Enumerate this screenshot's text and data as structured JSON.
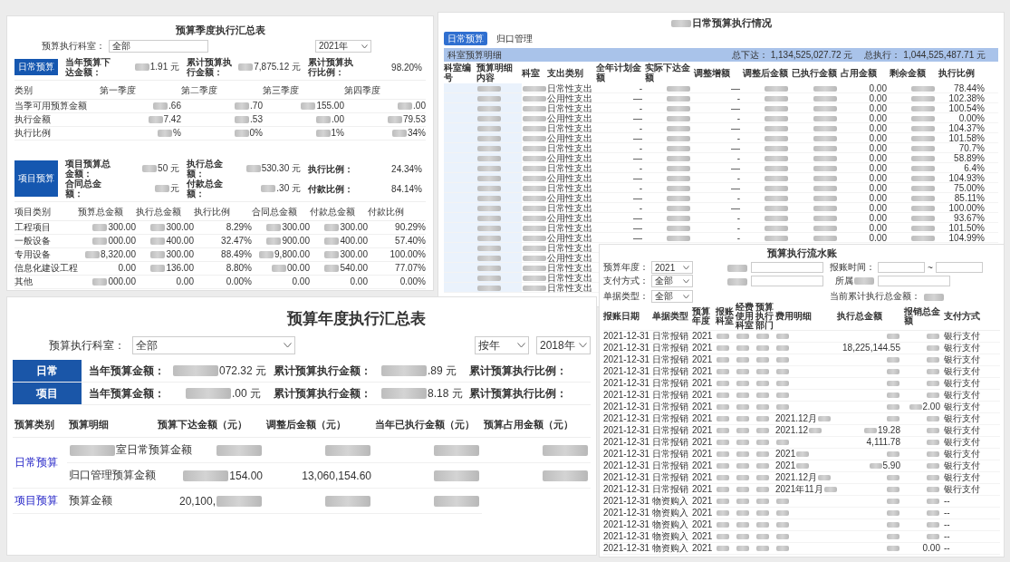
{
  "quarterly": {
    "title": "预算季度执行汇总表",
    "dept_label": "预算执行科室：",
    "dept_value": "全部",
    "year": "2021年",
    "daily_button": "日常预算",
    "daily_summary": [
      {
        "label": "当年预算下达金额：",
        "value": {
          "masked": true,
          "text": "1.91 元"
        }
      },
      {
        "label": "累计预算执行金额：",
        "value": {
          "masked": true,
          "text": "7,875.12 元"
        }
      },
      {
        "label": "累计预算执行比例：",
        "value": "98.20%"
      }
    ],
    "columns": [
      "类别",
      "第一季度",
      "第二季度",
      "第三季度",
      "第四季度"
    ],
    "rows": [
      {
        "label": "当季可用预算金额",
        "cells": [
          {
            "masked": true,
            "text": ".66"
          },
          {
            "masked": true,
            "text": ".70"
          },
          {
            "masked": true,
            "text": "155.00"
          },
          {
            "masked": true,
            "text": ".00"
          }
        ]
      },
      {
        "label": "执行金额",
        "cells": [
          {
            "masked": true,
            "text": "7.42"
          },
          {
            "masked": true,
            "text": ".53"
          },
          {
            "masked": true,
            "text": ".00"
          },
          {
            "masked": true,
            "text": "79.53"
          }
        ]
      },
      {
        "label": "执行比例",
        "cells": [
          {
            "masked": true,
            "text": "%"
          },
          {
            "masked": true,
            "text": "0%"
          },
          {
            "masked": true,
            "text": "1%"
          },
          {
            "masked": true,
            "text": "34%"
          }
        ]
      }
    ],
    "project_button": "项目预算",
    "project_summary": [
      {
        "label": "项目预算总金额：",
        "value": {
          "masked": true,
          "text": "50 元"
        }
      },
      {
        "label": "执行总金额：",
        "value": {
          "masked": true,
          "text": "530.30 元"
        }
      },
      {
        "label": "执行比例：",
        "value": "24.34%"
      },
      {
        "label": "合同总金额：",
        "value": {
          "masked": true,
          "text": "元"
        }
      },
      {
        "label": "付款总金额：",
        "value": {
          "masked": true,
          "text": ".30 元"
        }
      },
      {
        "label": "付款比例：",
        "value": "84.14%"
      }
    ],
    "project_columns": [
      "项目类别",
      "预算总金额",
      "执行总金额",
      "执行比例",
      "合同总金额",
      "付款总金额",
      "付款比例"
    ],
    "project_rows": [
      {
        "label": "工程项目",
        "cells": [
          {
            "masked": true,
            "text": "300.00"
          },
          {
            "masked": true,
            "text": "300.00"
          },
          "8.29%",
          {
            "masked": true,
            "text": "300.00"
          },
          {
            "masked": true,
            "text": "300.00"
          },
          "90.29%"
        ]
      },
      {
        "label": "一般设备",
        "cells": [
          {
            "masked": true,
            "text": "000.00"
          },
          {
            "masked": true,
            "text": "400.00"
          },
          "32.47%",
          {
            "masked": true,
            "text": "900.00"
          },
          {
            "masked": true,
            "text": "400.00"
          },
          "57.40%"
        ]
      },
      {
        "label": "专用设备",
        "cells": [
          {
            "masked": true,
            "text": "8,320.00"
          },
          {
            "masked": true,
            "text": "300.00"
          },
          "88.49%",
          {
            "masked": true,
            "text": "9,800.00"
          },
          {
            "masked": true,
            "text": "300.00"
          },
          "100.00%"
        ]
      },
      {
        "label": "信息化建设工程",
        "cells": [
          "0.00",
          {
            "masked": true,
            "text": "136.00"
          },
          "8.80%",
          {
            "masked": true,
            "text": "00.00"
          },
          {
            "masked": true,
            "text": "540.00"
          },
          "77.07%"
        ]
      },
      {
        "label": "其他",
        "cells": [
          {
            "masked": true,
            "text": "000.00"
          },
          "0.00",
          "0.00%",
          "0.00",
          "0.00",
          "0.00%"
        ]
      }
    ]
  },
  "daily_status": {
    "title": {
      "masked": true,
      "text": "日常预算执行情况"
    },
    "tabs": [
      {
        "label": "日常预算",
        "selected": true
      },
      {
        "label": "归口管理",
        "selected": false
      }
    ],
    "bar_label": "科室预算明细",
    "totals": [
      {
        "label": "总下达：",
        "value": "1,134,525,027.72 元"
      },
      {
        "label": "总执行：",
        "value": "1,044,525,487.71 元"
      }
    ],
    "columns": [
      "科室编号",
      "预算明细内容",
      "科室",
      "支出类别",
      "全年计划金额",
      "实际下达金额",
      "调整增额",
      "调整后金额",
      "已执行金额",
      "占用金额",
      "剩余金额",
      "执行比例"
    ],
    "rows": [
      [
        "",
        {
          "masked": true
        },
        {
          "masked": true
        },
        "日常性支出",
        "-",
        {
          "masked": true
        },
        "—",
        {
          "masked": true
        },
        {
          "masked": true
        },
        "0.00",
        {
          "masked": true
        },
        "78.44%"
      ],
      [
        "",
        {
          "masked": true
        },
        {
          "masked": true
        },
        "公用性支出",
        "—",
        {
          "masked": true
        },
        "-",
        {
          "masked": true
        },
        {
          "masked": true
        },
        "0.00",
        {
          "masked": true
        },
        "102.38%"
      ],
      [
        "",
        {
          "masked": true
        },
        {
          "masked": true
        },
        "日常性支出",
        "-",
        {
          "masked": true
        },
        "—",
        {
          "masked": true
        },
        {
          "masked": true
        },
        "0.00",
        {
          "masked": true
        },
        "100.54%"
      ],
      [
        "",
        {
          "masked": true
        },
        {
          "masked": true
        },
        "公用性支出",
        "—",
        {
          "masked": true
        },
        "-",
        {
          "masked": true
        },
        {
          "masked": true
        },
        "0.00",
        {
          "masked": true
        },
        "0.00%"
      ],
      [
        "",
        {
          "masked": true
        },
        {
          "masked": true
        },
        "日常性支出",
        "-",
        {
          "masked": true
        },
        "—",
        {
          "masked": true
        },
        {
          "masked": true
        },
        "0.00",
        {
          "masked": true
        },
        "104.37%"
      ],
      [
        "",
        {
          "masked": true
        },
        {
          "masked": true
        },
        "公用性支出",
        "—",
        {
          "masked": true
        },
        "-",
        {
          "masked": true
        },
        {
          "masked": true
        },
        "0.00",
        {
          "masked": true
        },
        "101.58%"
      ],
      [
        "",
        {
          "masked": true
        },
        {
          "masked": true
        },
        "日常性支出",
        "-",
        {
          "masked": true
        },
        "—",
        {
          "masked": true
        },
        {
          "masked": true
        },
        "0.00",
        {
          "masked": true
        },
        "70.7%"
      ],
      [
        "",
        {
          "masked": true
        },
        {
          "masked": true
        },
        "公用性支出",
        "—",
        {
          "masked": true
        },
        "-",
        {
          "masked": true
        },
        {
          "masked": true
        },
        "0.00",
        {
          "masked": true
        },
        "58.89%"
      ],
      [
        "",
        {
          "masked": true
        },
        {
          "masked": true
        },
        "日常性支出",
        "-",
        {
          "masked": true
        },
        "—",
        {
          "masked": true
        },
        {
          "masked": true
        },
        "0.00",
        {
          "masked": true
        },
        "6.4%"
      ],
      [
        "",
        {
          "masked": true
        },
        {
          "masked": true
        },
        "公用性支出",
        "—",
        {
          "masked": true
        },
        "-",
        {
          "masked": true
        },
        {
          "masked": true
        },
        "0.00",
        {
          "masked": true
        },
        "104.93%"
      ],
      [
        "",
        {
          "masked": true
        },
        {
          "masked": true
        },
        "日常性支出",
        "-",
        {
          "masked": true
        },
        "—",
        {
          "masked": true
        },
        {
          "masked": true
        },
        "0.00",
        {
          "masked": true
        },
        "75.00%"
      ],
      [
        "",
        {
          "masked": true
        },
        {
          "masked": true
        },
        "公用性支出",
        "—",
        {
          "masked": true
        },
        "-",
        {
          "masked": true
        },
        {
          "masked": true
        },
        "0.00",
        {
          "masked": true
        },
        "85.11%"
      ],
      [
        "",
        {
          "masked": true
        },
        {
          "masked": true
        },
        "日常性支出",
        "-",
        {
          "masked": true
        },
        "—",
        {
          "masked": true
        },
        {
          "masked": true
        },
        "0.00",
        {
          "masked": true
        },
        "100.00%"
      ],
      [
        "",
        {
          "masked": true
        },
        {
          "masked": true
        },
        "公用性支出",
        "—",
        {
          "masked": true
        },
        "-",
        {
          "masked": true
        },
        {
          "masked": true
        },
        "0.00",
        {
          "masked": true
        },
        "93.67%"
      ],
      [
        "",
        {
          "masked": true
        },
        {
          "masked": true
        },
        "日常性支出",
        "—",
        {
          "masked": true
        },
        "-",
        {
          "masked": true
        },
        {
          "masked": true
        },
        "0.00",
        {
          "masked": true
        },
        "101.50%"
      ],
      [
        "",
        {
          "masked": true
        },
        {
          "masked": true
        },
        "公用性支出",
        "—",
        {
          "masked": true
        },
        "-",
        {
          "masked": true
        },
        {
          "masked": true
        },
        "0.00",
        {
          "masked": true
        },
        "104.99%"
      ],
      [
        "",
        {
          "masked": true
        },
        {
          "masked": true
        },
        "日常性支出"
      ],
      [
        "",
        {
          "masked": true
        },
        {
          "masked": true
        },
        "公用性支出"
      ],
      [
        "",
        {
          "masked": true
        },
        {
          "masked": true
        },
        "日常性支出"
      ],
      [
        "",
        {
          "masked": true
        },
        {
          "masked": true
        },
        "日常性支出"
      ],
      [
        "",
        {
          "masked": true
        },
        {
          "masked": true
        },
        "日常性支出"
      ]
    ]
  },
  "ledger": {
    "title": "预算执行流水账",
    "filter_rows": [
      [
        {
          "kind": "select",
          "label": "预算年度：",
          "value": "2021"
        },
        {
          "kind": "input",
          "label": {
            "masked": true
          }
        },
        {
          "kind": "range",
          "label": "报账时间：",
          "sep": "~"
        }
      ],
      [
        {
          "kind": "select",
          "label": "支付方式：",
          "value": "全部"
        },
        {
          "kind": "input",
          "label": {
            "masked": true
          }
        },
        {
          "kind": "input",
          "label": {
            "masked": true,
            "lead": "所属"
          }
        }
      ],
      [
        {
          "kind": "select",
          "label": "单据类型：",
          "value": "全部"
        },
        {
          "kind": "total",
          "label": "当前累计执行总金额：",
          "value": {
            "masked": true
          }
        }
      ]
    ],
    "columns": [
      "报账日期",
      "单据类型",
      "预算年度",
      "报账科室",
      "经费使用科室",
      "预算执行部门",
      "费用明细",
      "执行总金额",
      "报销总金额",
      "支付方式"
    ],
    "rows": [
      [
        "2021-12-31",
        "日常报销",
        "2021",
        {
          "masked": true
        },
        {
          "masked": true
        },
        {
          "masked": true
        },
        {
          "masked": true
        },
        {
          "masked": true
        },
        {
          "masked": true
        },
        "银行支付"
      ],
      [
        "2021-12-31",
        "日常报销",
        "2021",
        {
          "masked": true
        },
        {
          "masked": true
        },
        {
          "masked": true
        },
        {
          "masked": true
        },
        "18,225,144.55",
        {
          "masked": true
        },
        "银行支付"
      ],
      [
        "2021-12-31",
        "日常报销",
        "2021",
        {
          "masked": true
        },
        {
          "masked": true
        },
        {
          "masked": true
        },
        {
          "masked": true
        },
        {
          "masked": true
        },
        {
          "masked": true
        },
        "银行支付"
      ],
      [
        "2021-12-31",
        "日常报销",
        "2021",
        {
          "masked": true
        },
        {
          "masked": true
        },
        {
          "masked": true
        },
        {
          "masked": true
        },
        {
          "masked": true
        },
        {
          "masked": true
        },
        "银行支付"
      ],
      [
        "2021-12-31",
        "日常报销",
        "2021",
        {
          "masked": true
        },
        {
          "masked": true
        },
        {
          "masked": true
        },
        {
          "masked": true
        },
        {
          "masked": true
        },
        {
          "masked": true
        },
        "银行支付"
      ],
      [
        "2021-12-31",
        "日常报销",
        "2021",
        {
          "masked": true
        },
        {
          "masked": true
        },
        {
          "masked": true
        },
        {
          "masked": true
        },
        {
          "masked": true
        },
        {
          "masked": true
        },
        "银行支付"
      ],
      [
        "2021-12-31",
        "日常报销",
        "2021",
        {
          "masked": true
        },
        {
          "masked": true
        },
        {
          "masked": true
        },
        {
          "masked": true
        },
        {
          "masked": true
        },
        {
          "masked": true,
          "text": "2.00"
        },
        "银行支付"
      ],
      [
        "2021-12-31",
        "日常报销",
        "2021",
        {
          "masked": true
        },
        {
          "masked": true
        },
        {
          "masked": true
        },
        {
          "masked": true,
          "lead": "2021.12月"
        },
        {
          "masked": true
        },
        {
          "masked": true
        },
        "银行支付"
      ],
      [
        "2021-12-31",
        "日常报销",
        "2021",
        {
          "masked": true
        },
        {
          "masked": true
        },
        {
          "masked": true
        },
        {
          "masked": true,
          "lead": "2021.12"
        },
        {
          "masked": true,
          "text": "19.28"
        },
        {
          "masked": true
        },
        "银行支付"
      ],
      [
        "2021-12-31",
        "日常报销",
        "2021",
        {
          "masked": true
        },
        {
          "masked": true
        },
        {
          "masked": true
        },
        {
          "masked": true
        },
        "4,111.78",
        {
          "masked": true
        },
        "银行支付"
      ],
      [
        "2021-12-31",
        "日常报销",
        "2021",
        {
          "masked": true
        },
        {
          "masked": true
        },
        {
          "masked": true
        },
        {
          "masked": true,
          "lead": "2021"
        },
        {
          "masked": true
        },
        {
          "masked": true
        },
        "银行支付"
      ],
      [
        "2021-12-31",
        "日常报销",
        "2021",
        {
          "masked": true
        },
        {
          "masked": true
        },
        {
          "masked": true
        },
        {
          "masked": true,
          "lead": "2021"
        },
        {
          "masked": true,
          "text": "5.90"
        },
        {
          "masked": true
        },
        "银行支付"
      ],
      [
        "2021-12-31",
        "日常报销",
        "2021",
        {
          "masked": true
        },
        {
          "masked": true
        },
        {
          "masked": true
        },
        {
          "masked": true,
          "lead": "2021.12月"
        },
        {
          "masked": true
        },
        {
          "masked": true
        },
        "银行支付"
      ],
      [
        "2021-12-31",
        "日常报销",
        "2021",
        {
          "masked": true
        },
        {
          "masked": true
        },
        {
          "masked": true
        },
        {
          "masked": true,
          "lead": "2021年11月"
        },
        {
          "masked": true
        },
        {
          "masked": true
        },
        "银行支付"
      ],
      [
        "2021-12-31",
        "物资购入",
        "2021",
        {
          "masked": true
        },
        {
          "masked": true
        },
        {
          "masked": true
        },
        {
          "masked": true
        },
        {
          "masked": true
        },
        {
          "masked": true
        },
        "--"
      ],
      [
        "2021-12-31",
        "物资购入",
        "2021",
        {
          "masked": true
        },
        {
          "masked": true
        },
        {
          "masked": true
        },
        {
          "masked": true
        },
        {
          "masked": true
        },
        {
          "masked": true
        },
        "--"
      ],
      [
        "2021-12-31",
        "物资购入",
        "2021",
        {
          "masked": true
        },
        {
          "masked": true
        },
        {
          "masked": true
        },
        {
          "masked": true
        },
        {
          "masked": true
        },
        {
          "masked": true
        },
        "--"
      ],
      [
        "2021-12-31",
        "物资购入",
        "2021",
        {
          "masked": true
        },
        {
          "masked": true
        },
        {
          "masked": true
        },
        {
          "masked": true
        },
        {
          "masked": true
        },
        {
          "masked": true
        },
        "--"
      ],
      [
        "2021-12-31",
        "物资购入",
        "2021",
        {
          "masked": true
        },
        {
          "masked": true
        },
        {
          "masked": true
        },
        {
          "masked": true
        },
        {
          "masked": true
        },
        "0.00",
        "--"
      ]
    ]
  },
  "annual": {
    "title": "预算年度执行汇总表",
    "dept_label": "预算执行科室：",
    "dept_value": "全部",
    "selects": [
      "按年",
      "2018年"
    ],
    "summary": [
      {
        "tab": "日常",
        "pairs": [
          {
            "label": "当年预算金额：",
            "value": {
              "masked": true,
              "text": "072.32 元"
            }
          },
          {
            "label": "累计预算执行金额：",
            "value": {
              "masked": true,
              "text": ".89 元"
            }
          },
          {
            "label": "累计预算执行比例："
          }
        ]
      },
      {
        "tab": "项目",
        "pairs": [
          {
            "label": "当年预算金额：",
            "value": {
              "masked": true,
              "text": ".00 元"
            }
          },
          {
            "label": "累计预算执行金额：",
            "value": {
              "masked": true,
              "text": "8.18 元"
            }
          },
          {
            "label": "累计预算执行比例："
          }
        ]
      }
    ],
    "columns": [
      "预算类别",
      "预算明细",
      "预算下达金额（元）",
      "调整后金额（元）",
      "当年已执行金额（元）",
      "预算占用金额（元）"
    ],
    "groups": [
      {
        "category": "日常预算",
        "items": [
          {
            "detail": {
              "masked": true,
              "text": "室日常预算金额"
            },
            "cells": [
              {
                "masked": true
              },
              {
                "masked": true
              },
              {
                "masked": true
              },
              {
                "masked": true
              }
            ]
          },
          {
            "detail": "归口管理预算金额",
            "cells": [
              {
                "masked": true,
                "text": "154.00"
              },
              "13,060,154.60",
              {
                "masked": true
              },
              {
                "masked": true
              }
            ]
          }
        ]
      },
      {
        "category": "项目预算",
        "items": [
          {
            "detail": "预算金额",
            "cells": [
              {
                "masked": true,
                "lead": "20,100,"
              },
              {
                "masked": true
              },
              {
                "masked": true
              }
            ]
          }
        ]
      }
    ]
  }
}
